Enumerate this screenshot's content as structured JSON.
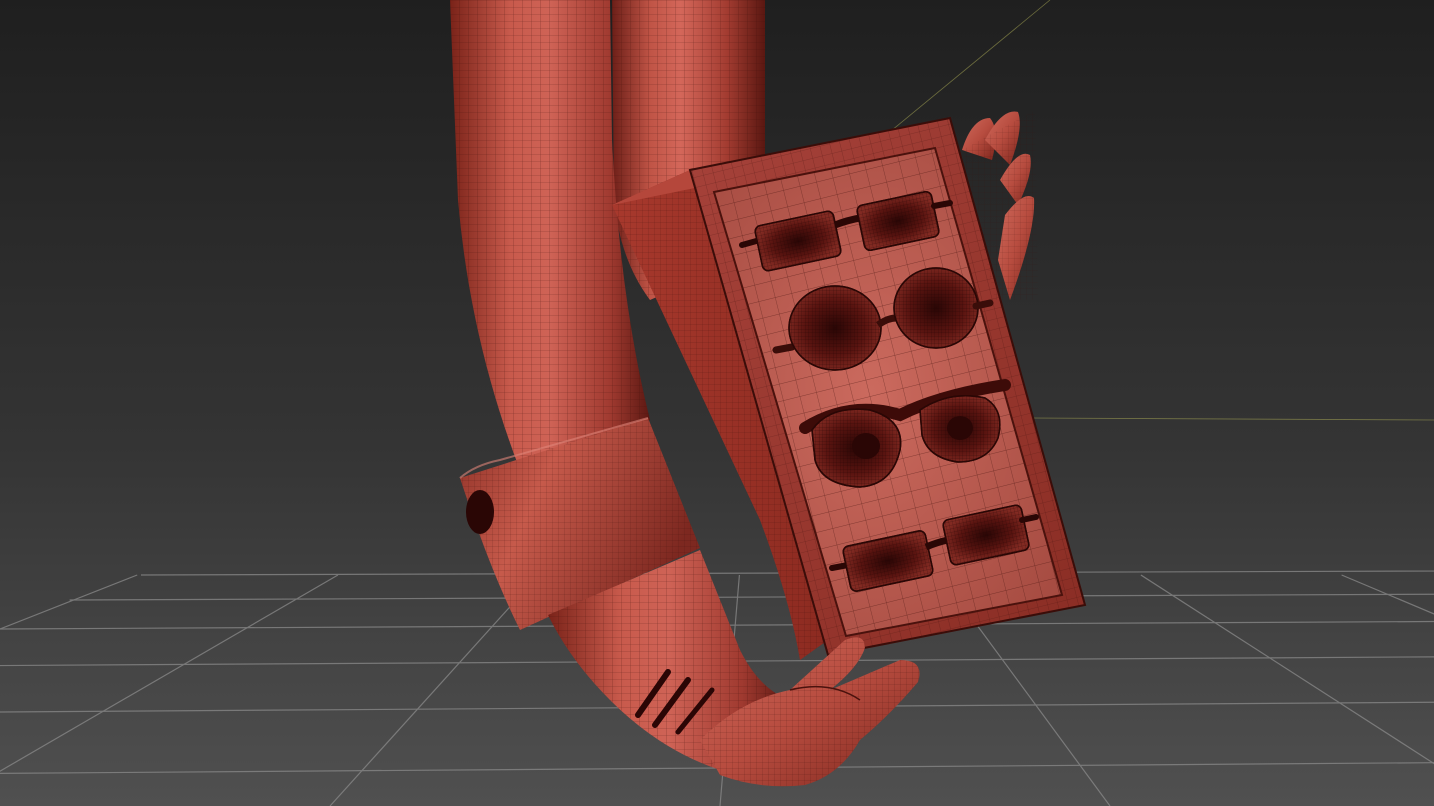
{
  "viewport": {
    "background_top": "#1f1f1f",
    "background_bottom": "#505050",
    "grid_line": "#8a8a8a",
    "axis_line": "#b7b75a"
  },
  "model": {
    "base_color": "#b0463a",
    "highlight_color": "#d4675a",
    "shadow_color": "#6d1f18",
    "wire_color": "#3a0d09",
    "inlay_color": "#3d0b08"
  }
}
